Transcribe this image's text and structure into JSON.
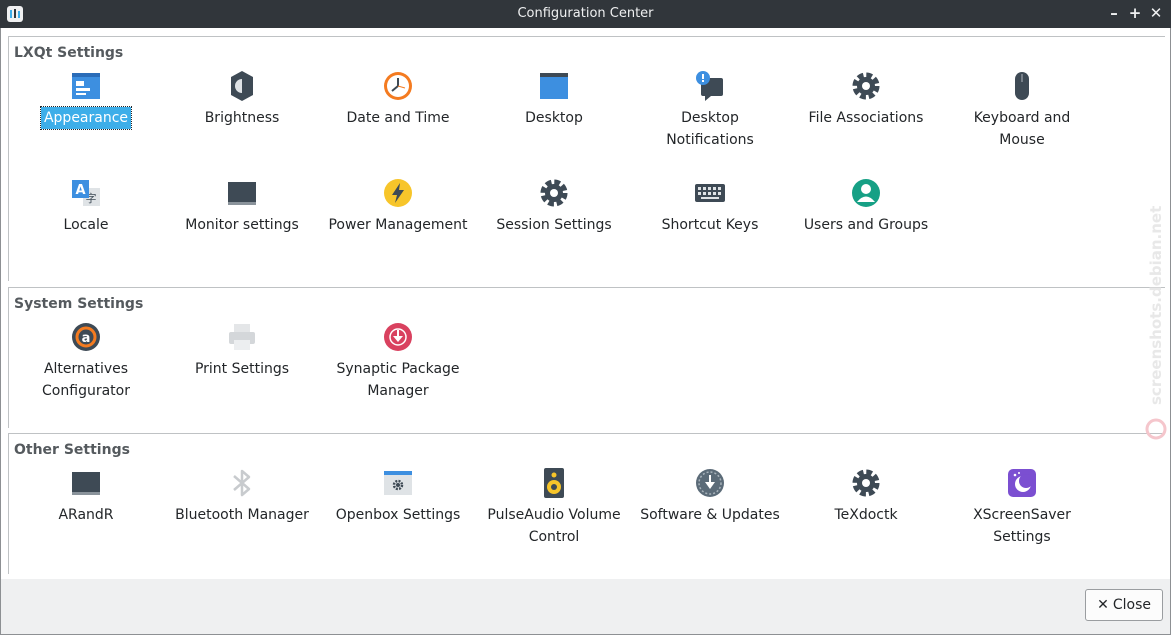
{
  "window": {
    "title": "Configuration Center"
  },
  "groups": [
    {
      "title": "LXQt Settings",
      "items": [
        {
          "label": "Appearance",
          "icon": "appearance-icon",
          "selected": true
        },
        {
          "label": "Brightness",
          "icon": "brightness-icon"
        },
        {
          "label": "Date and Time",
          "icon": "clock-icon"
        },
        {
          "label": "Desktop",
          "icon": "desktop-icon"
        },
        {
          "label": "Desktop Notifications",
          "icon": "notification-icon"
        },
        {
          "label": "File Associations",
          "icon": "gear-icon"
        },
        {
          "label": "Keyboard and Mouse",
          "icon": "mouse-icon"
        },
        {
          "label": "Locale",
          "icon": "locale-icon"
        },
        {
          "label": "Monitor settings",
          "icon": "monitor-icon"
        },
        {
          "label": "Power Management",
          "icon": "power-icon"
        },
        {
          "label": "Session Settings",
          "icon": "gear-icon"
        },
        {
          "label": "Shortcut Keys",
          "icon": "keyboard-icon"
        },
        {
          "label": "Users and Groups",
          "icon": "user-icon"
        }
      ]
    },
    {
      "title": "System Settings",
      "items": [
        {
          "label": "Alternatives Configurator",
          "icon": "alternatives-icon"
        },
        {
          "label": "Print Settings",
          "icon": "printer-icon"
        },
        {
          "label": "Synaptic Package Manager",
          "icon": "synaptic-icon"
        }
      ]
    },
    {
      "title": "Other Settings",
      "items": [
        {
          "label": "ARandR",
          "icon": "monitor-icon"
        },
        {
          "label": "Bluetooth Manager",
          "icon": "bluetooth-icon"
        },
        {
          "label": "Openbox Settings",
          "icon": "openbox-icon"
        },
        {
          "label": "PulseAudio Volume Control",
          "icon": "speaker-icon"
        },
        {
          "label": "Software & Updates",
          "icon": "software-updates-icon"
        },
        {
          "label": "TeXdoctk",
          "icon": "gear-icon"
        },
        {
          "label": "XScreenSaver Settings",
          "icon": "screensaver-icon"
        }
      ]
    }
  ],
  "footer": {
    "close_label": "Close"
  },
  "watermark": {
    "text": "screenshots.debian.net"
  }
}
